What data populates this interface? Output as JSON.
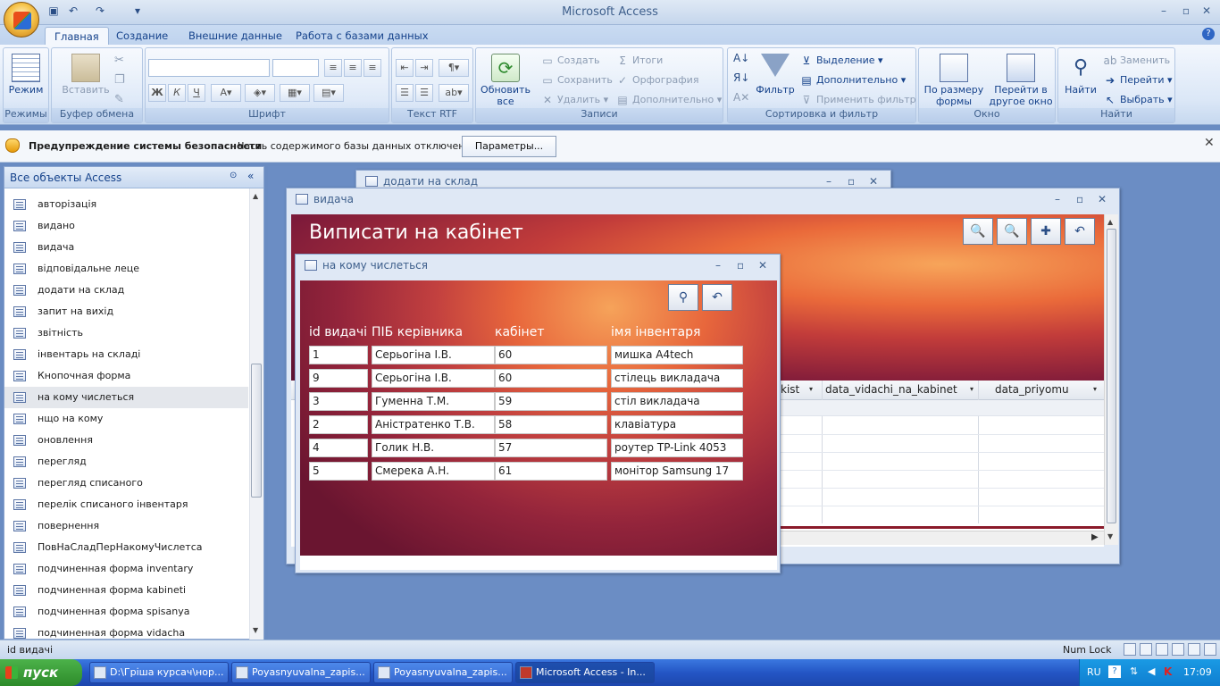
{
  "app": {
    "title": "Microsoft Access"
  },
  "tabs": [
    "Главная",
    "Создание",
    "Внешние данные",
    "Работа с базами данных"
  ],
  "ribbon": {
    "groups": {
      "modes": "Режимы",
      "clipboard": "Буфер обмена",
      "font": "Шрифт",
      "rtf": "Текст RTF",
      "records": "Записи",
      "sort": "Сортировка и фильтр",
      "window": "Окно",
      "find": "Найти"
    },
    "mode_btn": "Режим",
    "paste_btn": "Вставить",
    "refresh_btn_1": "Обновить",
    "refresh_btn_2": "все",
    "create": "Создать",
    "save": "Сохранить",
    "delete": "Удалить",
    "totals": "Итоги",
    "spelling": "Орфография",
    "more": "Дополнительно",
    "filter": "Фильтр",
    "selection": "Выделение",
    "advanced": "Дополнительно",
    "toggle_filter": "Применить фильтр",
    "fit_form_1": "По размеру",
    "fit_form_2": "формы",
    "switch_win_1": "Перейти в",
    "switch_win_2": "другое окно",
    "find": "Найти",
    "replace": "Заменить",
    "goto": "Перейти",
    "select": "Выбрать"
  },
  "security": {
    "title": "Предупреждение системы безопасности",
    "text": "Часть содержимого базы данных отключено",
    "button": "Параметры..."
  },
  "nav": {
    "title": "Все объекты Access",
    "items": [
      "авторізація",
      "видано",
      "видача",
      "відповідальне леце",
      "додати на склад",
      "запит на вихід",
      "звітність",
      "інвентарь на складі",
      "Кнопочная форма",
      "на кому числеться",
      "нщо на кому",
      "оновлення",
      "перегляд",
      "перегляд списаного",
      "перелік списаного інвентаря",
      "повернення",
      "ПовНаСладПерНакомуЧислетса",
      "подчиненная форма inventary",
      "подчиненная форма kabineti",
      "подчиненная форма spisanya",
      "подчиненная форма vidacha"
    ]
  },
  "win_back": {
    "title": "додати на склад"
  },
  "win_vidacha": {
    "title": "видача",
    "heading": "Виписати на кабінет",
    "col_kist": "kist",
    "col_data_vidachi": "data_vidachi_na_kabinet",
    "col_data_priyomu": "data_priyomu"
  },
  "win_front": {
    "title": "на кому числеться",
    "headers": [
      "id видачі",
      "ПІБ керівника",
      "кабінет",
      "імя інвентаря"
    ],
    "rows": [
      [
        "1",
        "Серьогіна І.В.",
        "60",
        "мишка A4tech"
      ],
      [
        "9",
        "Серьогіна І.В.",
        "60",
        "стілець викладача"
      ],
      [
        "3",
        "Гуменна Т.М.",
        "59",
        "стіл викладача"
      ],
      [
        "2",
        "Аністратенко Т.В.",
        "58",
        "клавіатура"
      ],
      [
        "4",
        "Голик Н.В.",
        "57",
        "роутер TP-Link 4053"
      ],
      [
        "5",
        "Смерека А.Н.",
        "61",
        "монітор Samsung 17"
      ]
    ]
  },
  "status": {
    "left": "id видачі",
    "numlock": "Num Lock"
  },
  "taskbar": {
    "start": "пуск",
    "tasks": [
      "D:\\Гріша курсач\\нор...",
      "Poyasnyuvalna_zapis...",
      "Poyasnyuvalna_zapis...",
      "Microsoft Access - In..."
    ],
    "lang": "RU",
    "time": "17:09"
  }
}
